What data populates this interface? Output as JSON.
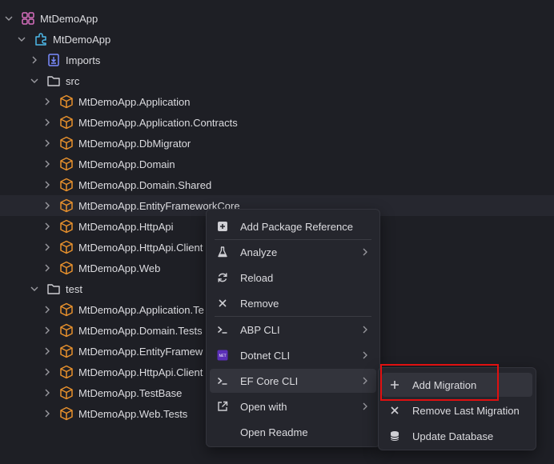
{
  "tree": {
    "solution": "MtDemoApp",
    "project": "MtDemoApp",
    "imports": "Imports",
    "src": "src",
    "test": "test",
    "src_items": [
      "MtDemoApp.Application",
      "MtDemoApp.Application.Contracts",
      "MtDemoApp.DbMigrator",
      "MtDemoApp.Domain",
      "MtDemoApp.Domain.Shared",
      "MtDemoApp.EntityFrameworkCore",
      "MtDemoApp.HttpApi",
      "MtDemoApp.HttpApi.Client",
      "MtDemoApp.Web"
    ],
    "test_items": [
      "MtDemoApp.Application.Te",
      "MtDemoApp.Domain.Tests",
      "MtDemoApp.EntityFramew",
      "MtDemoApp.HttpApi.Client",
      "MtDemoApp.TestBase",
      "MtDemoApp.Web.Tests"
    ]
  },
  "context_menu": {
    "items": [
      {
        "label": "Add Package Reference",
        "icon": "add-package-icon"
      },
      {
        "label": "Analyze",
        "icon": "flask-icon"
      },
      {
        "label": "Reload",
        "icon": "reload-icon"
      },
      {
        "label": "Remove",
        "icon": "close-icon"
      },
      {
        "label": "ABP CLI",
        "icon": "terminal-icon"
      },
      {
        "label": "Dotnet CLI",
        "icon": "dotnet-icon"
      },
      {
        "label": "EF Core CLI",
        "icon": "terminal-icon"
      },
      {
        "label": "Open with",
        "icon": "open-external-icon"
      },
      {
        "label": "Open Readme",
        "icon": ""
      }
    ]
  },
  "submenu": {
    "items": [
      {
        "label": "Add Migration",
        "icon": "plus-icon"
      },
      {
        "label": "Remove Last Migration",
        "icon": "close-icon"
      },
      {
        "label": "Update Database",
        "icon": "database-icon"
      }
    ]
  },
  "colors": {
    "background": "#1e1f25",
    "menu_bg": "#25262d",
    "project_orange": "#e8912d",
    "highlight_red": "#e01010"
  }
}
